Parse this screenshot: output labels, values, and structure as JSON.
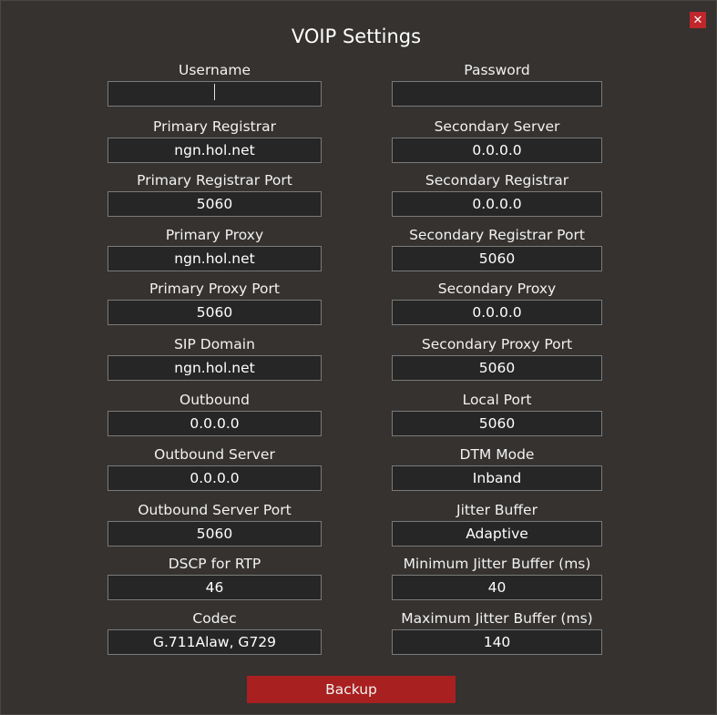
{
  "dialog": {
    "title": "VOIP Settings",
    "close_label": "✕",
    "backup_label": "Backup"
  },
  "left_fields": [
    {
      "label": "Username",
      "value": ""
    },
    {
      "label": "Primary Registrar",
      "value": "ngn.hol.net"
    },
    {
      "label": "Primary Registrar Port",
      "value": "5060"
    },
    {
      "label": "Primary Proxy",
      "value": "ngn.hol.net"
    },
    {
      "label": "Primary Proxy Port",
      "value": "5060"
    },
    {
      "label": "SIP Domain",
      "value": "ngn.hol.net"
    },
    {
      "label": "Outbound",
      "value": "0.0.0.0"
    },
    {
      "label": "Outbound Server",
      "value": "0.0.0.0"
    },
    {
      "label": "Outbound Server Port",
      "value": "5060"
    },
    {
      "label": "DSCP for RTP",
      "value": "46"
    },
    {
      "label": "Codec",
      "value": "G.711Alaw, G729"
    }
  ],
  "right_fields": [
    {
      "label": "Password",
      "value": ""
    },
    {
      "label": "Secondary Server",
      "value": "0.0.0.0"
    },
    {
      "label": "Secondary Registrar",
      "value": "0.0.0.0"
    },
    {
      "label": "Secondary Registrar Port",
      "value": "5060"
    },
    {
      "label": "Secondary Proxy",
      "value": "0.0.0.0"
    },
    {
      "label": "Secondary Proxy Port",
      "value": "5060"
    },
    {
      "label": "Local Port",
      "value": "5060"
    },
    {
      "label": "DTM Mode",
      "value": "Inband"
    },
    {
      "label": "Jitter Buffer",
      "value": "Adaptive"
    },
    {
      "label": "Minimum Jitter Buffer (ms)",
      "value": "40"
    },
    {
      "label": "Maximum Jitter Buffer (ms)",
      "value": "140"
    }
  ]
}
